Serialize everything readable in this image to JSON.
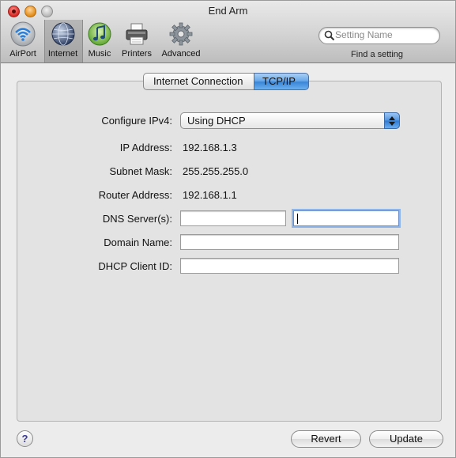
{
  "window": {
    "title": "End Arm"
  },
  "toolbar": {
    "items": [
      {
        "label": "AirPort",
        "icon": "airport-icon"
      },
      {
        "label": "Internet",
        "icon": "internet-globe-icon",
        "selected": true
      },
      {
        "label": "Music",
        "icon": "music-note-icon"
      },
      {
        "label": "Printers",
        "icon": "printer-icon"
      },
      {
        "label": "Advanced",
        "icon": "gear-icon"
      }
    ],
    "search": {
      "placeholder": "Setting Name",
      "caption": "Find a setting"
    }
  },
  "tabs": [
    {
      "label": "Internet Connection",
      "active": false
    },
    {
      "label": "TCP/IP",
      "active": true
    }
  ],
  "form": {
    "configure_ipv4": {
      "label": "Configure IPv4:",
      "value": "Using DHCP"
    },
    "ip_address": {
      "label": "IP Address:",
      "value": "192.168.1.3"
    },
    "subnet_mask": {
      "label": "Subnet Mask:",
      "value": "255.255.255.0"
    },
    "router_address": {
      "label": "Router Address:",
      "value": "192.168.1.1"
    },
    "dns_servers": {
      "label": "DNS Server(s):",
      "value1": "",
      "value2": ""
    },
    "domain_name": {
      "label": "Domain Name:",
      "value": ""
    },
    "dhcp_client_id": {
      "label": "DHCP Client ID:",
      "value": ""
    }
  },
  "footer": {
    "help_label": "?",
    "revert_label": "Revert",
    "update_label": "Update"
  },
  "colors": {
    "accent": "#4f94e0",
    "close": "#d7251f",
    "minimize": "#e18a16",
    "zoom": "#b8b8b8"
  }
}
